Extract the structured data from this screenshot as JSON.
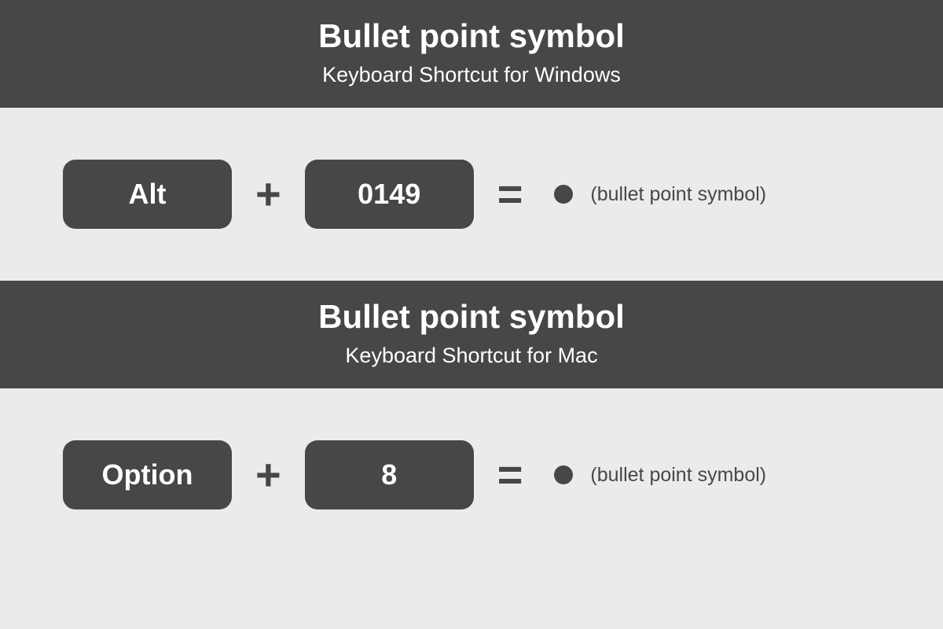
{
  "sections": [
    {
      "title": "Bullet point symbol",
      "subtitle": "Keyboard Shortcut for Windows",
      "key1": "Alt",
      "plus": "+",
      "key2": "0149",
      "equals": "=",
      "result_label": "(bullet point symbol)"
    },
    {
      "title": "Bullet point symbol",
      "subtitle": "Keyboard Shortcut for Mac",
      "key1": "Option",
      "plus": "+",
      "key2": "8",
      "equals": "=",
      "result_label": "(bullet point symbol)"
    }
  ]
}
